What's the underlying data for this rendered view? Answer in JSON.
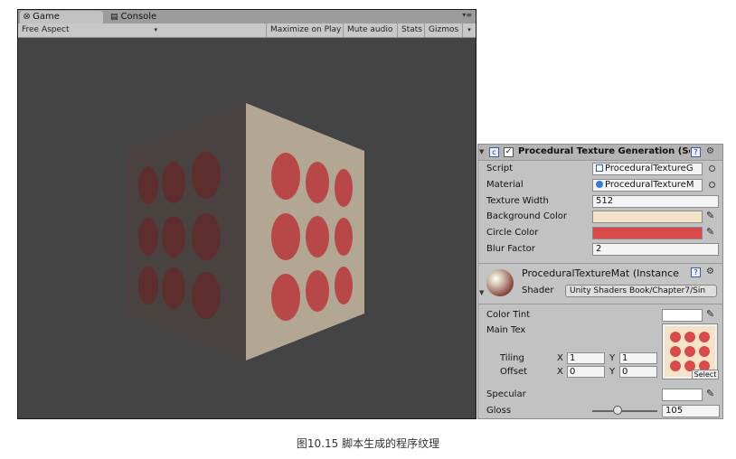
{
  "game_window": {
    "tabs": [
      {
        "label": "Game",
        "icon": "unity-game-icon"
      },
      {
        "label": "Console",
        "icon": "console-icon"
      }
    ],
    "toolbar": {
      "aspect": "Free Aspect",
      "maximize_on_play": "Maximize on Play",
      "mute_audio": "Mute audio",
      "stats": "Stats",
      "gizmos": "Gizmos"
    },
    "viewport_bg": "#444444"
  },
  "inspector": {
    "component_title": "Procedural Texture Generation (Sc",
    "component_enabled": true,
    "script": {
      "label": "Script",
      "value": "ProceduralTextureG"
    },
    "material": {
      "label": "Material",
      "value": "ProceduralTextureM"
    },
    "texture_width": {
      "label": "Texture Width",
      "value": "512"
    },
    "background_color": {
      "label": "Background Color",
      "color": "#f3e3c8"
    },
    "circle_color": {
      "label": "Circle Color",
      "color": "#d94a4a"
    },
    "blur_factor": {
      "label": "Blur Factor",
      "value": "2"
    },
    "material_header": {
      "title": "ProceduralTextureMat (Instance",
      "shader_label": "Shader",
      "shader_value": "Unity Shaders Book/Chapter7/Sin"
    },
    "color_tint": {
      "label": "Color Tint",
      "color": "#ffffff"
    },
    "main_tex": {
      "label": "Main Tex",
      "tiling_label": "Tiling",
      "offset_label": "Offset",
      "x_label": "X",
      "y_label": "Y",
      "tiling_x": "1",
      "tiling_y": "1",
      "offset_x": "0",
      "offset_y": "0",
      "select_label": "Select",
      "texture_bg": "#f3e3c8",
      "texture_dot": "#d94a4a"
    },
    "specular": {
      "label": "Specular",
      "color": "#ffffff"
    },
    "gloss": {
      "label": "Gloss",
      "value": "105",
      "slider_fraction": 0.4
    }
  },
  "caption": "图10.15 脚本生成的程序纹理"
}
